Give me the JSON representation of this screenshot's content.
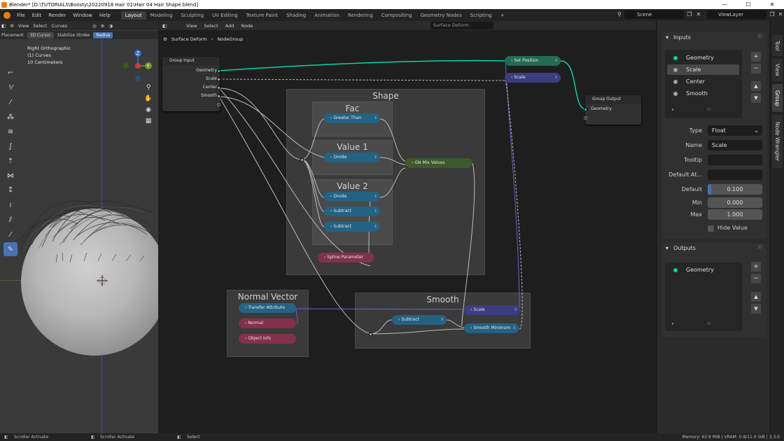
{
  "window": {
    "title": "Blender* [D:\\TUTORIALS\\Boosty\\20220918 Hair 01\\Hair 04 Hair Shape.blend]",
    "controls": [
      "—",
      "☐",
      "✕"
    ]
  },
  "menu": [
    "File",
    "Edit",
    "Render",
    "Window",
    "Help"
  ],
  "workspaces": [
    "Layout",
    "Modeling",
    "Sculpting",
    "UV Editing",
    "Texture Paint",
    "Shading",
    "Animation",
    "Rendering",
    "Compositing",
    "Geometry Nodes",
    "Scripting",
    "+"
  ],
  "scene": "Scene",
  "view_layer": "ViewLayer",
  "viewport": {
    "header": [
      "View",
      "Select",
      "Curves"
    ],
    "header2": {
      "placement": "Placement",
      "cursor": "3D Cursor",
      "stabilize": "Stabilize Stroke",
      "radius": "Radius"
    },
    "info": [
      "Right Orthographic",
      "(1) Curves",
      "10 Centimeters"
    ],
    "gizmo": {
      "z": "Z",
      "y": "Y"
    }
  },
  "node_editor": {
    "header": [
      "View",
      "Select",
      "Add",
      "Node"
    ],
    "modifier_field": "Surface Deform",
    "breadcrumb": [
      "Surface Deform",
      "NodeGroup"
    ],
    "frames": {
      "shape": "Shape",
      "fac": "Fac",
      "value1": "Value 1",
      "value2": "Value 2",
      "normal_vector": "Normal Vector",
      "smooth": "Smooth"
    },
    "group_input": {
      "title": "Group Input",
      "sockets": [
        "Geometry",
        "Scale",
        "Center",
        "Smooth"
      ]
    },
    "group_output": {
      "title": "Group Output",
      "sockets": [
        "Geometry"
      ]
    },
    "nodes": {
      "set_position": "Set Position",
      "scale_top": "Scale",
      "greater_than": "Greater Than",
      "divide1": "Divide",
      "divide2": "Divide",
      "subtract1": "Subtract",
      "subtract2": "Subtract",
      "mix": "GN Mix Values",
      "spline_param": "Spline Parameter",
      "transfer_attr": "Transfer Attribute",
      "normal": "Normal",
      "object_info": "Object Info",
      "scale_smooth": "Scale",
      "subtract_smooth": "Subtract",
      "smooth_min": "Smooth Minimum"
    }
  },
  "sidebar": {
    "tabs": [
      "Tool",
      "View",
      "Group",
      "Node Wrangler"
    ],
    "active_tab": "Group",
    "inputs": {
      "title": "Inputs",
      "items": [
        "Geometry",
        "Scale",
        "Center",
        "Smooth"
      ],
      "selected": "Scale"
    },
    "props": {
      "type_label": "Type",
      "type_value": "Float",
      "name_label": "Name",
      "name_value": "Scale",
      "tooltip_label": "Tooltip",
      "tooltip_value": "",
      "default_attr_label": "Default At...",
      "default_attr_value": "",
      "default_label": "Default",
      "default_value": "0.100",
      "min_label": "Min",
      "min_value": "0.000",
      "max_label": "Max",
      "max_value": "1.000",
      "hide_value_label": "Hide Value"
    },
    "outputs": {
      "title": "Outputs",
      "items": [
        "Geometry"
      ]
    }
  },
  "status": {
    "left1": "Scroller Activate",
    "left2": "Scroller Activate",
    "left3": "Select",
    "right": "Memory: 63.9 MiB | VRAM: 0.9/11.0 GiB | 3.3.0"
  },
  "colors": {
    "accent": "#4772b3",
    "geometry": "#00d6a3",
    "vector": "#6363c7",
    "float": "#a1a1a1",
    "orange": "#e87d0d"
  }
}
